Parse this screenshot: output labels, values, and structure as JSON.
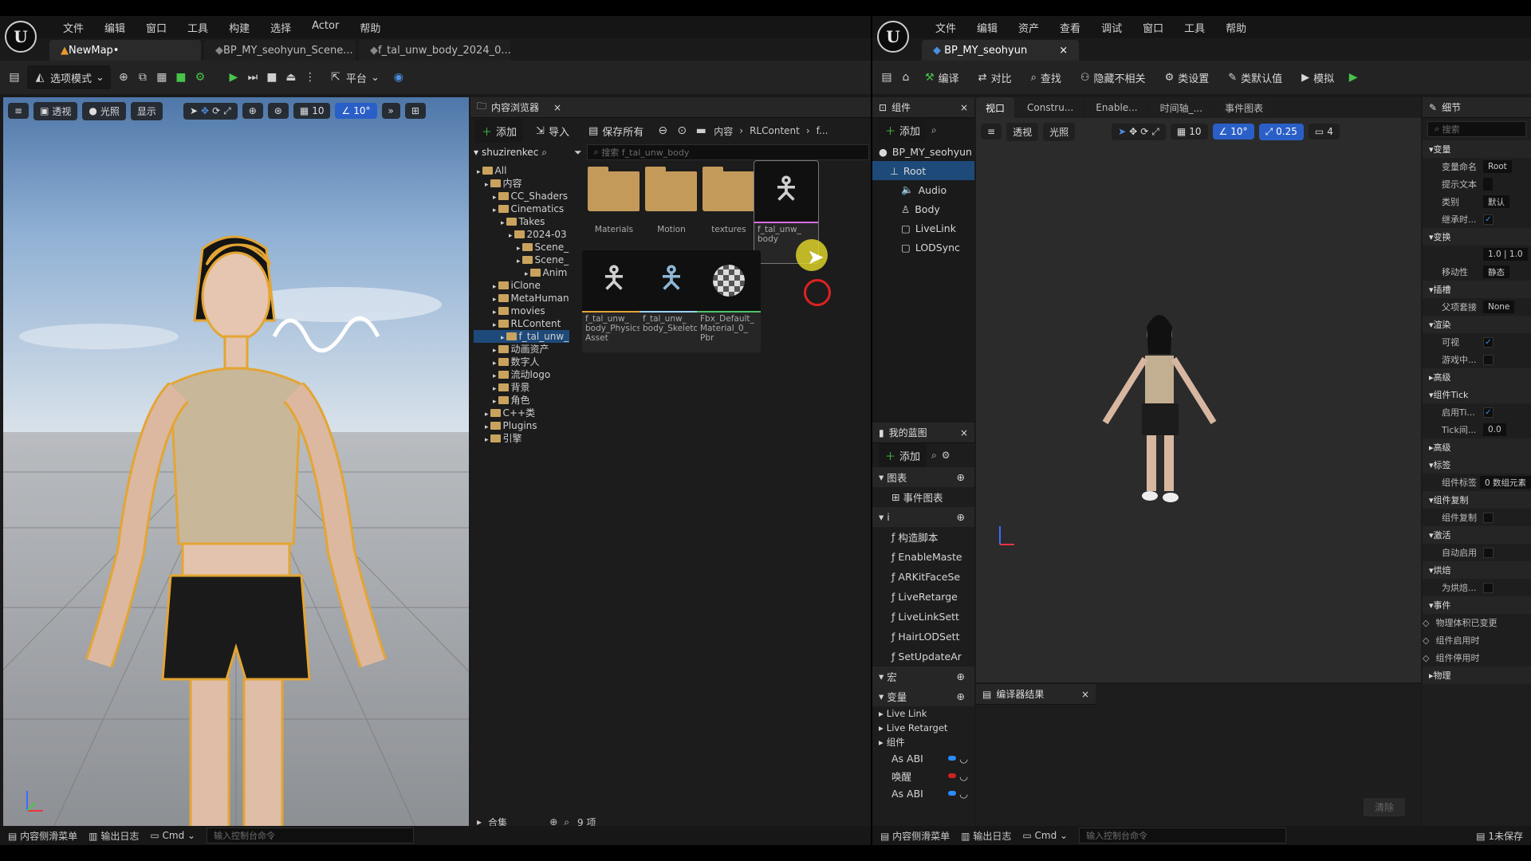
{
  "left_window": {
    "menu": [
      "文件",
      "编辑",
      "窗口",
      "工具",
      "构建",
      "选择",
      "Actor",
      "帮助"
    ],
    "tabs": [
      "NewMap•",
      "BP_MY_seohyun_Scene...",
      "f_tal_unw_body_2024_0..."
    ],
    "toolbar": {
      "mode": "选项模式",
      "platform": "平台"
    },
    "viewport": {
      "perspective": "透视",
      "lit": "光照",
      "show": "显示",
      "grid": "10",
      "angle": "10°"
    },
    "content_browser": {
      "title": "内容浏览器",
      "add": "添加",
      "import": "导入",
      "save_all": "保存所有",
      "breadcrumb": [
        "内容",
        "RLContent",
        "f..."
      ],
      "tree_header": "shuzirenkec",
      "search_placeholder": "搜索 f_tal_unw_body",
      "tree": [
        "All",
        "内容",
        "CC_Shaders",
        "Cinematics",
        "Takes",
        "2024-03",
        "Scene_",
        "Scene_",
        "Anim",
        "iClone",
        "MetaHuman",
        "movies",
        "RLContent",
        "f_tal_unw_",
        "动画资产",
        "数字人",
        "流动logo",
        "背景",
        "角色",
        "C++类",
        "Plugins",
        "引擎"
      ],
      "assets": [
        {
          "label": "Materials"
        },
        {
          "label": "Motion"
        },
        {
          "label": "textures"
        },
        {
          "label": "f_tal_unw_ body"
        },
        {
          "label": "f_tal_unw_ body_Physics Asset"
        },
        {
          "label": "f_tal_unw_ body_Skeleton"
        },
        {
          "label": "Fbx_Default_ Material_0_ Pbr"
        }
      ],
      "collections": "合集",
      "item_count": "9 项"
    },
    "status": {
      "drawer": "内容侧滑菜单",
      "output_log": "输出日志",
      "cmd": "Cmd",
      "console_placeholder": "输入控制台命令"
    }
  },
  "right_window": {
    "menu": [
      "文件",
      "编辑",
      "资产",
      "查看",
      "调试",
      "窗口",
      "工具",
      "帮助"
    ],
    "tab": "BP_MY_seohyun",
    "toolbar": [
      "编译",
      "对比",
      "查找",
      "隐藏不相关",
      "类设置",
      "类默认值",
      "模拟"
    ],
    "components": {
      "title": "组件",
      "add": "添加",
      "items": [
        "BP_MY_seohyun",
        "Root",
        "Audio",
        "Body",
        "LiveLink",
        "LODSync"
      ]
    },
    "editor_tabs": [
      "视口",
      "Constru...",
      "Enable...",
      "时间轴_...",
      "事件图表"
    ],
    "viewport": {
      "perspective": "透视",
      "lit": "光照",
      "grid": "10",
      "angle": "10°",
      "scale": "0.25",
      "cam": "4"
    },
    "my_blueprint": {
      "title": "我的蓝图",
      "add": "添加",
      "graphs_header": "图表",
      "event_graph": "事件图表",
      "functions_header": "i",
      "functions": [
        "构造脚本",
        "EnableMaste",
        "ARKitFaceSe",
        "LiveRetarge",
        "LiveLinkSett",
        "HairLODSett",
        "SetUpdateAr"
      ],
      "macros_header": "宏",
      "variables_header": "变量",
      "var_groups": [
        "Live Link",
        "Live Retarget",
        "组件"
      ],
      "vars": [
        "As ABI",
        "唤醒",
        "As ABI"
      ]
    },
    "compiler": {
      "title": "编译器结果",
      "clear": "清除"
    },
    "details": {
      "title": "细节",
      "search_placeholder": "搜索",
      "sections": [
        {
          "name": "变量",
          "rows": [
            [
              "变量命名",
              "Root"
            ],
            [
              "提示文本",
              ""
            ],
            [
              "类别",
              "默认"
            ],
            [
              "继承时...",
              "check"
            ]
          ]
        },
        {
          "name": "变换",
          "rows": [
            [
              "",
              "1.0 | 1.0"
            ],
            [
              "移动性",
              "静态"
            ]
          ]
        },
        {
          "name": "插槽",
          "rows": [
            [
              "父项套接",
              "None"
            ]
          ]
        },
        {
          "name": "渲染",
          "rows": [
            [
              "可视",
              "check"
            ],
            [
              "游戏中...",
              "box"
            ]
          ]
        },
        {
          "name": "高级",
          "rows": []
        },
        {
          "name": "组件Tick",
          "rows": [
            [
              "启用Ti...",
              "check"
            ],
            [
              "Tick间...",
              "0.0"
            ]
          ]
        },
        {
          "name": "高级",
          "rows": []
        },
        {
          "name": "标签",
          "rows": [
            [
              "组件标签",
              "0 数组元素"
            ]
          ]
        },
        {
          "name": "组件复制",
          "rows": [
            [
              "组件复制",
              "box"
            ]
          ]
        },
        {
          "name": "激活",
          "rows": [
            [
              "自动启用",
              "box"
            ]
          ]
        },
        {
          "name": "烘焙",
          "rows": [
            [
              "为烘焙...",
              "box"
            ]
          ]
        },
        {
          "name": "事件",
          "rows": [
            [
              "物理体积已变更",
              "ev"
            ],
            [
              "组件启用时",
              "ev"
            ],
            [
              "组件停用时",
              "ev"
            ]
          ]
        },
        {
          "name": "物理",
          "rows": []
        }
      ]
    },
    "status": {
      "drawer": "内容侧滑菜单",
      "output_log": "输出日志",
      "cmd": "Cmd",
      "console_placeholder": "输入控制台命令",
      "unsaved": "1未保存"
    }
  },
  "colors": {
    "accent_blue": "#2a5fc7",
    "play_green": "#47c44a",
    "folder": "#c49a5a",
    "selection": "#1e4a7a",
    "outline": "#e3a534"
  }
}
